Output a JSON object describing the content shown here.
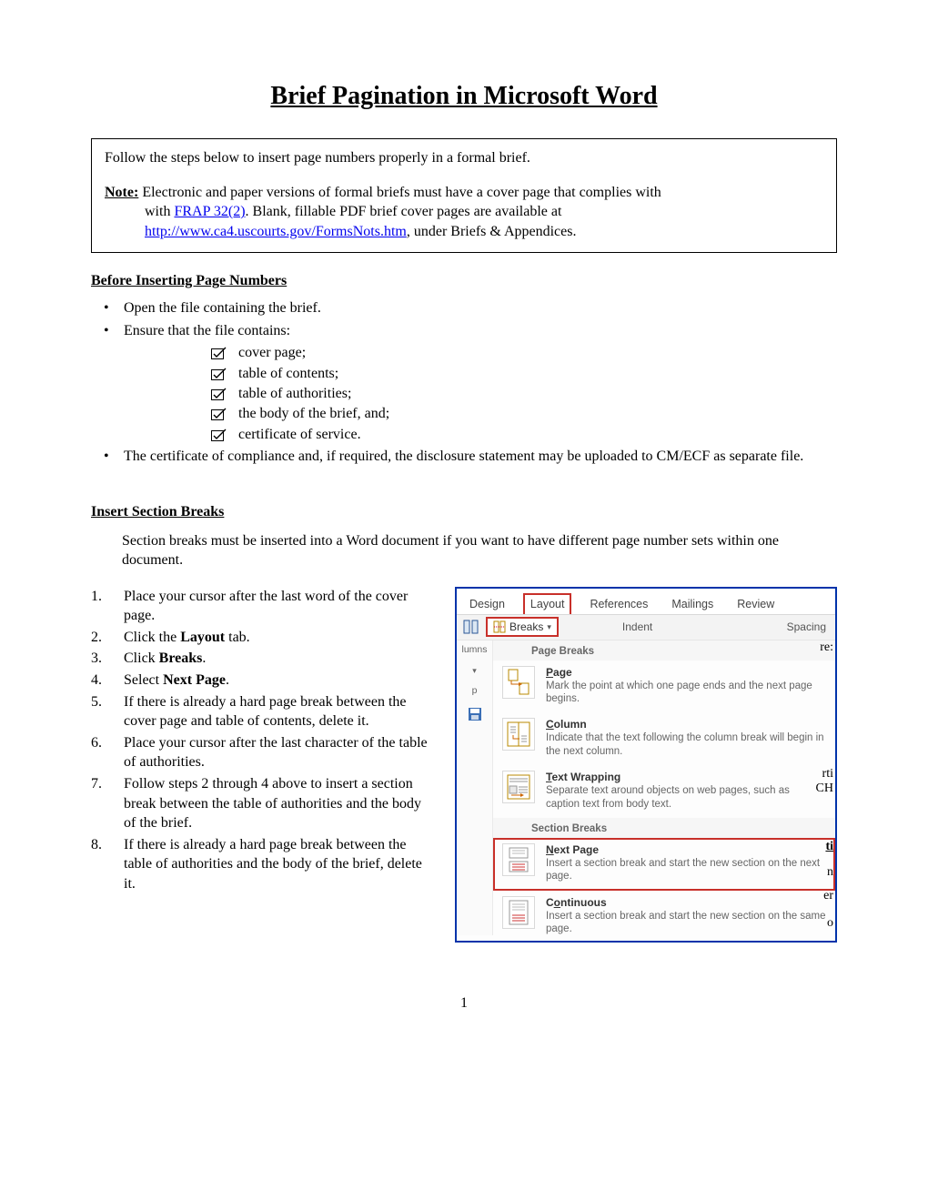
{
  "title": "Brief Pagination in Microsoft Word",
  "note_box": {
    "intro": "Follow the steps below to insert page numbers properly in a formal brief.",
    "note_label": "Note:",
    "note_text_1": " Electronic and paper versions of formal briefs must have a cover page that complies with ",
    "frap_link": "FRAP 32(2)",
    "note_text_2": ". Blank, fillable PDF brief cover pages are available at ",
    "url_link": "http://www.ca4.uscourts.gov/FormsNots.htm",
    "note_text_3": ", under Briefs & Appendices."
  },
  "section1": {
    "heading": "Before Inserting Page Numbers",
    "bullets": {
      "b1": "Open the file containing the brief.",
      "b2": "Ensure that the file contains:",
      "b3": "The certificate of compliance and, if required, the disclosure statement may be uploaded to CM/ECF as separate file."
    },
    "checklist": {
      "c1": "cover page;",
      "c2": "table of contents;",
      "c3": "table of authorities;",
      "c4": "the body of the brief, and;",
      "c5": "certificate of service."
    }
  },
  "section2": {
    "heading": "Insert Section Breaks",
    "intro": "Section breaks must be inserted into a Word document if you want to have different page number sets within one document.",
    "steps": {
      "s1a": "Place your cursor after the last word of the cover page.",
      "s2a": "Click the ",
      "s2b": "Layout",
      "s2c": " tab.",
      "s3a": "Click ",
      "s3b": "Breaks",
      "s3c": ".",
      "s4a": "Select ",
      "s4b": "Next Page",
      "s4c": ".",
      "s5": "If there is already a hard page break between the cover page and table of contents, delete it.",
      "s6": "Place your cursor after the last character of the table of authorities.",
      "s7": "Follow steps 2 through 4 above to insert a section break between the table of authorities and the body of the brief.",
      "s8": "If there is already a hard page break between the table of authorities and the body of the brief, delete it."
    }
  },
  "screenshot": {
    "tabs": {
      "design": "Design",
      "layout": "Layout",
      "references": "References",
      "mailings": "Mailings",
      "review": "Review"
    },
    "ribbon": {
      "breaks": "Breaks",
      "indent": "Indent",
      "spacing": "Spacing"
    },
    "gutter": {
      "lumns": "lumns",
      "p": "p"
    },
    "group_page": "Page Breaks",
    "group_section": "Section Breaks",
    "items": {
      "page_title": "Page",
      "page_desc": "Mark the point at which one page ends and the next page begins.",
      "column_title": "Column",
      "column_desc": "Indicate that the text following the column break will begin in the next column.",
      "wrap_title": "Text Wrapping",
      "wrap_desc": "Separate text around objects on web pages, such as caption text from body text.",
      "next_title": "Next Page",
      "next_desc": "Insert a section break and start the new section on the next page.",
      "cont_title": "Continuous",
      "cont_desc": "Insert a section break and start the new section on the same page."
    },
    "edge": {
      "re": "re:",
      "rti": "rti",
      "ch": "CH",
      "ti": "ti",
      "n": "n",
      "er": "er",
      "o": "o"
    }
  },
  "page_number": "1"
}
